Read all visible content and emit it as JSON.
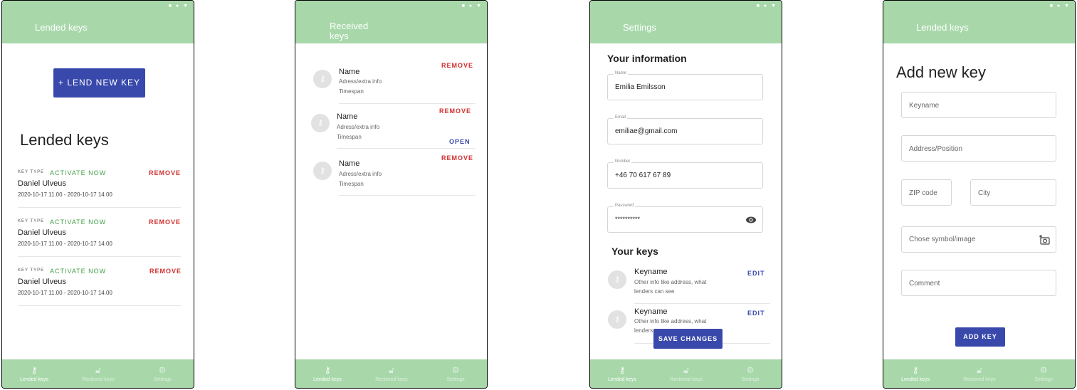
{
  "status_icons": "■ ● ▼",
  "bottom_nav": [
    {
      "icon": "key-icon",
      "glyph": "⚷",
      "label": "Lended keys"
    },
    {
      "icon": "lock-icon",
      "glyph": "🔓︎",
      "label": "Recieved keys"
    },
    {
      "icon": "gear-icon",
      "glyph": "⚙",
      "label": "Settings"
    }
  ],
  "screen1": {
    "app_title": "Lended keys",
    "lend_button": "+ LEND NEW KEY",
    "heading": "Lended keys",
    "items": [
      {
        "key_type": "KEY TYPE",
        "activate": "ACTIVATE NOW",
        "remove": "REMOVE",
        "name": "Daniel Ulveus",
        "time": "2020-10-17 11.00 - 2020-10-17 14.00"
      },
      {
        "key_type": "KEY TYPE",
        "activate": "ACTIVATE NOW",
        "remove": "REMOVE",
        "name": "Daniel Ulveus",
        "time": "2020-10-17 11.00 - 2020-10-17 14.00"
      },
      {
        "key_type": "KEY TYPE",
        "activate": "ACTIVATE NOW",
        "remove": "REMOVE",
        "name": "Daniel Ulveus",
        "time": "2020-10-17 11.00 - 2020-10-17 14.00"
      }
    ]
  },
  "screen2": {
    "app_title_line1": "Received",
    "app_title_line2": "keys",
    "items": [
      {
        "name": "Name",
        "address": "Adress/extra info",
        "timespan": "Timespan",
        "remove": "REMOVE"
      },
      {
        "name": "Name",
        "address": "Adress/extra info",
        "timespan": "Timespan",
        "remove": "REMOVE",
        "open": "OPEN"
      },
      {
        "name": "Name",
        "address": "Adress/extra info",
        "timespan": "Timespan",
        "remove": "REMOVE"
      }
    ]
  },
  "screen3": {
    "app_title": "Settings",
    "your_information": "Your information",
    "fields": {
      "name": {
        "label": "Name",
        "value": "Emilia Emilsson"
      },
      "email": {
        "label": "Email",
        "value": "emiliae@gmail.com"
      },
      "number": {
        "label": "Number",
        "value": "+46 70 617 67 89"
      },
      "password": {
        "label": "Password",
        "value": "**********"
      }
    },
    "your_keys": "Your keys",
    "keys": [
      {
        "name": "Keyname",
        "info_line1": "Other info like address, what",
        "info_line2": "lenders can see",
        "edit": "EDIT"
      },
      {
        "name": "Keyname",
        "info_line1": "Other info like address, what",
        "info_line2": "lenders can see",
        "edit": "EDIT"
      }
    ],
    "save_button": "SAVE CHANGES"
  },
  "screen4": {
    "app_title": "Lended keys",
    "heading": "Add new key",
    "placeholders": {
      "keyname": "Keyname",
      "address": "Address/Position",
      "zip": "ZIP code",
      "city": "City",
      "symbol": "Chose symbol/image",
      "comment": "Comment"
    },
    "add_button": "ADD KEY"
  }
}
